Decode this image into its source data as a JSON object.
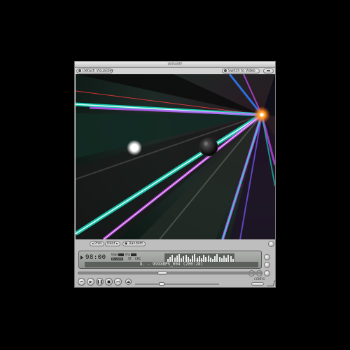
{
  "window": {
    "title": "WINAMP"
  },
  "toolbar": {
    "detach_label": "Detach Visualizer",
    "switch_label": "Switch to Video"
  },
  "vis_controls": {
    "prev_label": "Prev",
    "next_label": "Next",
    "random_label": "Random"
  },
  "display": {
    "time": "98:00",
    "kbps_value": "",
    "kbps_unit": "kbps",
    "khz_value": "",
    "khz_unit": "khz",
    "mode1": "ST",
    "mode2": "CRC",
    "status": "NO VIDEO",
    "spectrum_label": "NEW VIDEO BUTTON",
    "marquee": "8. - 999XBPS_004 (200:28)"
  },
  "seek": {
    "position": 0.45
  },
  "volume": {
    "level": 0.3
  },
  "config": {
    "label": "CONFIG"
  },
  "icons": [
    "detach-icon",
    "switch-icon",
    "close-icon",
    "prev-icon",
    "play-icon",
    "pause-icon",
    "stop-icon",
    "next-icon",
    "eject-icon"
  ],
  "colors": {
    "accent_cyan": "#16e6c8",
    "accent_magenta": "#d24dff",
    "lcd": "#9fa39f"
  }
}
